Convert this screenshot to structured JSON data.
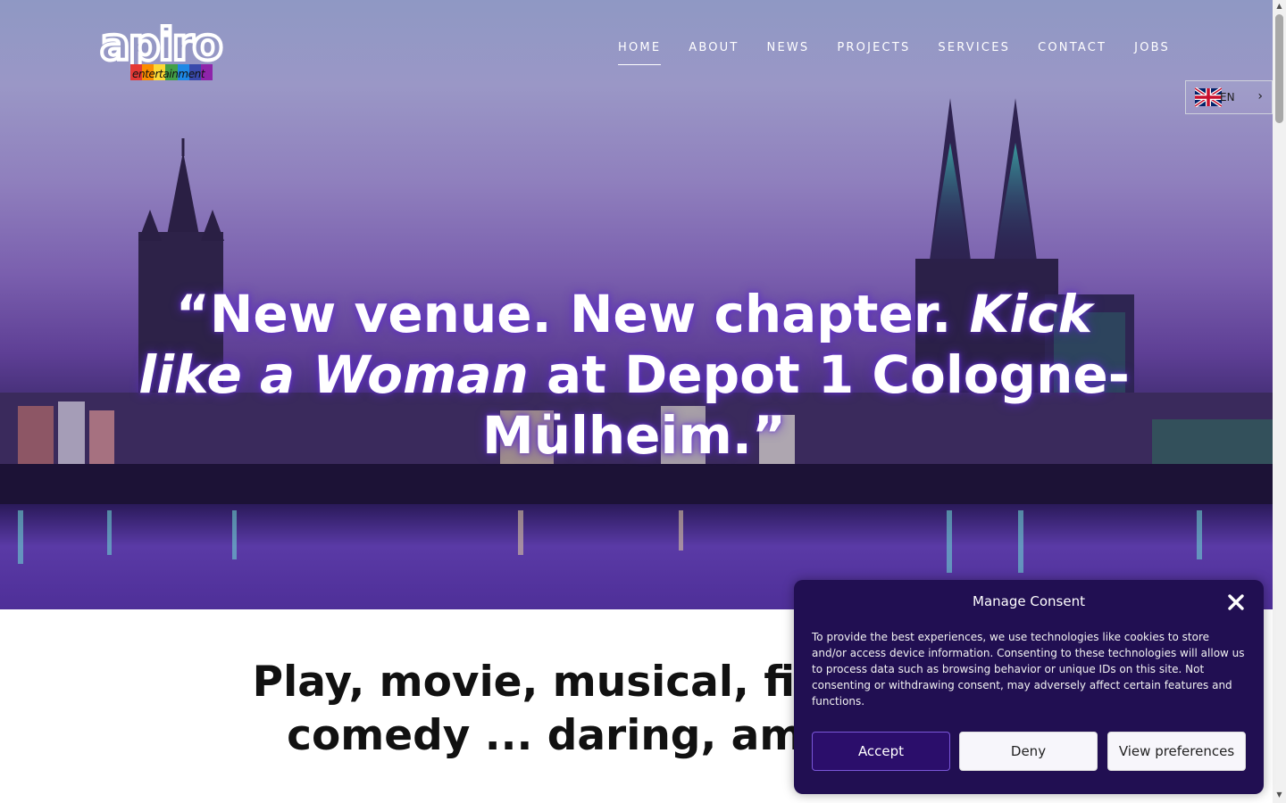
{
  "brand": {
    "logo_word": "apiro",
    "logo_sub": "entertainment",
    "logo_bar_colors": [
      "#e53935",
      "#fb8c00",
      "#fdd835",
      "#43a047",
      "#1e88e5",
      "#3949ab",
      "#8e24aa"
    ]
  },
  "nav": {
    "items": [
      {
        "label": "HOME",
        "active": true
      },
      {
        "label": "ABOUT"
      },
      {
        "label": "NEWS"
      },
      {
        "label": "PROJECTS"
      },
      {
        "label": "SERVICES"
      },
      {
        "label": "CONTACT"
      },
      {
        "label": "JOBS"
      }
    ]
  },
  "language": {
    "code": "EN",
    "flag_icon": "uk-flag-icon",
    "chevron_icon": "chevron-right-icon"
  },
  "hero": {
    "quote_open": "“New venue. New chapter. ",
    "quote_italic_1": "Kick like a Woman",
    "quote_rest": " at Depot 1 Cologne-Mülheim.”"
  },
  "tagline": "Play, movie, musical, film, show, comedy ... daring, ambitious!",
  "consent": {
    "title": "Manage Consent",
    "text": "To provide the best experiences, we use technologies like cookies to store and/or access device information. Consenting to these technologies will allow us to process data such as browsing behavior or unique IDs on this site. Not consenting or withdrawing consent, may adversely affect certain features and functions.",
    "accept_label": "Accept",
    "deny_label": "Deny",
    "preferences_label": "View preferences",
    "close_icon": "close-icon"
  },
  "colors": {
    "consent_bg": "#210f52",
    "accent": "#7a56d8"
  }
}
